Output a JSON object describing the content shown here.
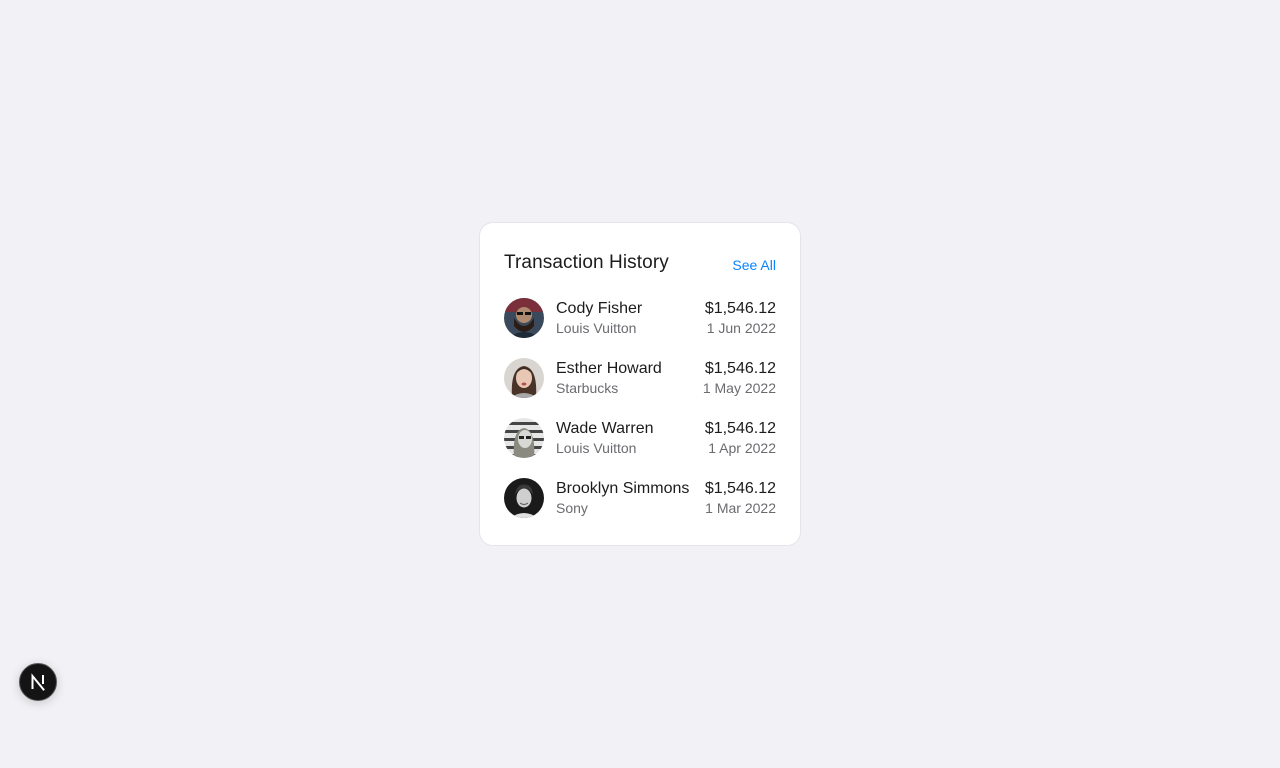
{
  "card": {
    "title": "Transaction History",
    "see_all_label": "See All"
  },
  "transactions": [
    {
      "name": "Cody Fisher",
      "merchant": "Louis Vuitton",
      "amount": "$1,546.12",
      "date": "1 Jun 2022"
    },
    {
      "name": "Esther Howard",
      "merchant": "Starbucks",
      "amount": "$1,546.12",
      "date": "1 May 2022"
    },
    {
      "name": "Wade Warren",
      "merchant": "Louis Vuitton",
      "amount": "$1,546.12",
      "date": "1 Apr 2022"
    },
    {
      "name": "Brooklyn Simmons",
      "merchant": "Sony",
      "amount": "$1,546.12",
      "date": "1 Mar 2022"
    }
  ],
  "colors": {
    "background": "#f2f2f6",
    "card": "#ffffff",
    "accent": "#0a84ff",
    "text_primary": "#1c1c1e",
    "text_secondary": "#6b6b70"
  },
  "icons": {
    "floating_badge": "nextjs-logo-icon"
  }
}
